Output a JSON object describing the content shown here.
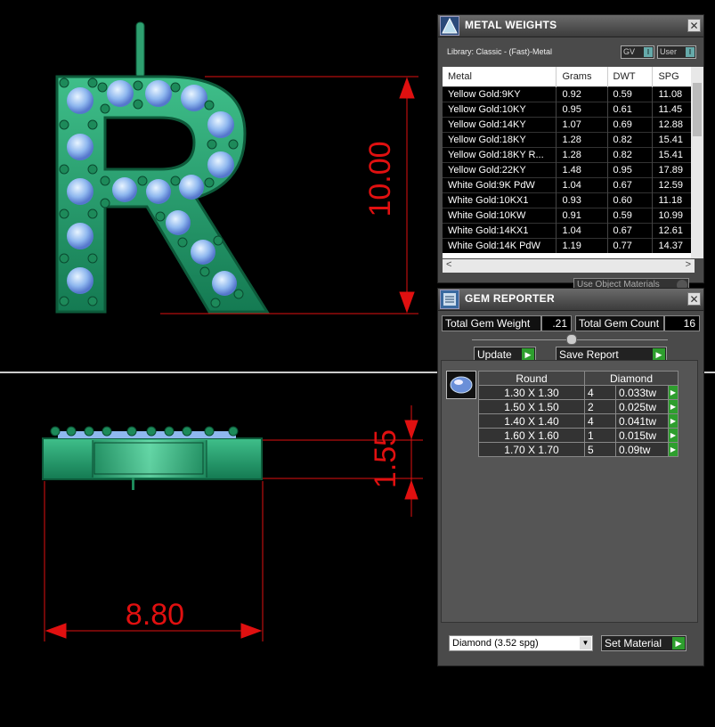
{
  "viewport": {
    "dimension_height": "10.00",
    "dimension_thickness": "1.55",
    "dimension_width": "8.80",
    "letter": "R"
  },
  "metal_panel": {
    "title": "METAL WEIGHTS",
    "library": "Library: Classic - (Fast)-Metal",
    "gv_label": "GV",
    "user_label": "User",
    "columns": [
      "Metal",
      "Grams",
      "DWT",
      "SPG"
    ],
    "rows": [
      [
        "Yellow Gold:9KY",
        "0.92",
        "0.59",
        "11.08"
      ],
      [
        "Yellow Gold:10KY",
        "0.95",
        "0.61",
        "11.45"
      ],
      [
        "Yellow Gold:14KY",
        "1.07",
        "0.69",
        "12.88"
      ],
      [
        "Yellow Gold:18KY",
        "1.28",
        "0.82",
        "15.41"
      ],
      [
        "Yellow Gold:18KY R...",
        "1.28",
        "0.82",
        "15.41"
      ],
      [
        "Yellow Gold:22KY",
        "1.48",
        "0.95",
        "17.89"
      ],
      [
        "White Gold:9K PdW",
        "1.04",
        "0.67",
        "12.59"
      ],
      [
        "White Gold:10KX1",
        "0.93",
        "0.60",
        "11.18"
      ],
      [
        "White Gold:10KW",
        "0.91",
        "0.59",
        "10.99"
      ],
      [
        "White Gold:14KX1",
        "1.04",
        "0.67",
        "12.61"
      ],
      [
        "White Gold:14K PdW",
        "1.19",
        "0.77",
        "14.37"
      ]
    ],
    "use_object_materials": "Use Object Materials"
  },
  "gem_panel": {
    "title": "GEM REPORTER",
    "total_weight_label": "Total Gem Weight",
    "total_weight_value": ".21",
    "total_count_label": "Total Gem Count",
    "total_count_value": "16",
    "update_label": "Update",
    "save_report_label": "Save Report",
    "columns": [
      "Round",
      "Diamond"
    ],
    "rows": [
      [
        "1.30 X 1.30",
        "4",
        "0.033tw"
      ],
      [
        "1.50 X 1.50",
        "2",
        "0.025tw"
      ],
      [
        "1.40 X 1.40",
        "4",
        "0.041tw"
      ],
      [
        "1.60 X 1.60",
        "1",
        "0.015tw"
      ],
      [
        "1.70 X 1.70",
        "5",
        "0.09tw"
      ]
    ],
    "material_select": "Diamond    (3.52 spg)",
    "set_material_label": "Set Material"
  }
}
